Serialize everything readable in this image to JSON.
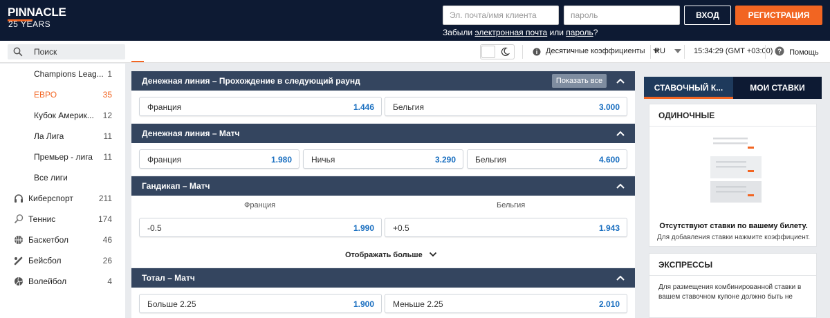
{
  "header": {
    "logo_main": "PINNACLE",
    "logo_sub": "25 YEARS",
    "email_placeholder": "Эл. почта/имя клиента",
    "password_placeholder": "пароль",
    "login_label": "ВХОД",
    "register_label": "РЕГИСТРАЦИЯ",
    "forgot_prefix": "Забыли ",
    "forgot_email": "электронная почта",
    "forgot_or": " или ",
    "forgot_password": "пароль",
    "forgot_suffix": "?"
  },
  "toolbar": {
    "search_label": "Поиск",
    "odds_format": "Десятичные коэффициенты",
    "language": "RU",
    "time": "15:34:29 (GMT +03:00)",
    "help": "Помощь"
  },
  "sidebar": {
    "items": [
      {
        "name": "Champions Leag...",
        "count": "1",
        "icon": "",
        "active": false
      },
      {
        "name": "ЕВРО",
        "count": "35",
        "icon": "",
        "active": true
      },
      {
        "name": "Кубок Америк...",
        "count": "12",
        "icon": "",
        "active": false
      },
      {
        "name": "Ла Лига",
        "count": "11",
        "icon": "",
        "active": false
      },
      {
        "name": "Премьер - лига",
        "count": "11",
        "icon": "",
        "active": false
      },
      {
        "name": "Все лиги",
        "count": "",
        "icon": "",
        "active": false
      },
      {
        "name": "Киберспорт",
        "count": "211",
        "icon": "headset-icon",
        "active": false
      },
      {
        "name": "Теннис",
        "count": "174",
        "icon": "tennis-icon",
        "active": false
      },
      {
        "name": "Баскетбол",
        "count": "46",
        "icon": "basketball-icon",
        "active": false
      },
      {
        "name": "Бейсбол",
        "count": "26",
        "icon": "baseball-icon",
        "active": false
      },
      {
        "name": "Волейбол",
        "count": "4",
        "icon": "volleyball-icon",
        "active": false
      }
    ]
  },
  "markets": {
    "m1": {
      "title": "Денежная линия – Прохождение в следующий раунд",
      "show_all": "Показать все",
      "odds": [
        {
          "label": "Франция",
          "value": "1.446"
        },
        {
          "label": "Бельгия",
          "value": "3.000"
        }
      ]
    },
    "m2": {
      "title": "Денежная линия – Матч",
      "odds": [
        {
          "label": "Франция",
          "value": "1.980"
        },
        {
          "label": "Ничья",
          "value": "3.290"
        },
        {
          "label": "Бельгия",
          "value": "4.600"
        }
      ]
    },
    "m3": {
      "title": "Гандикап – Матч",
      "col_home": "Франция",
      "col_away": "Бельгия",
      "odds": [
        {
          "label": "-0.5",
          "value": "1.990"
        },
        {
          "label": "+0.5",
          "value": "1.943"
        }
      ],
      "show_more": "Отображать больше"
    },
    "m4": {
      "title": "Тотал – Матч",
      "odds": [
        {
          "label": "Больше 2.25",
          "value": "1.900"
        },
        {
          "label": "Меньше 2.25",
          "value": "2.010"
        }
      ]
    }
  },
  "betslip": {
    "tab_slip": "СТАВОЧНЫЙ К...",
    "tab_mybets": "МОИ СТАВКИ",
    "singles_title": "ОДИНОЧНЫЕ",
    "empty_title": "Отсутствуют ставки по вашему билету.",
    "empty_sub": "Для добавления ставки нажмите коэффициент.",
    "parlays_title": "ЭКСПРЕССЫ",
    "parlays_text": "Для размещения комбинированной ставки в вашем ставочном купоне должно быть не"
  },
  "colors": {
    "accent": "#f26522",
    "header_bg": "#0d1a33",
    "market_header": "#34455f",
    "odds_value": "#1a6fc0"
  }
}
